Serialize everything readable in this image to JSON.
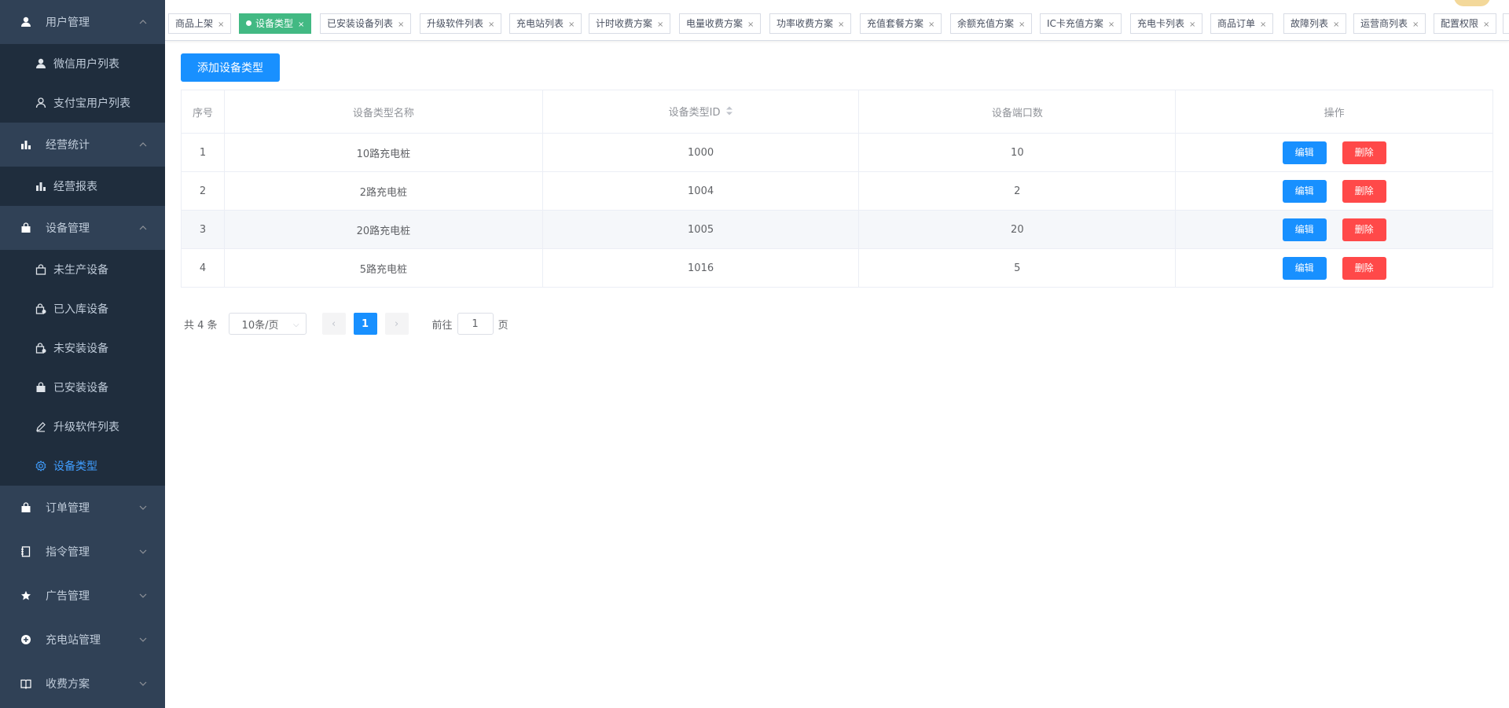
{
  "sidebar": {
    "groups": [
      {
        "label": "用户管理",
        "items": [
          "微信用户列表",
          "支付宝用户列表"
        ]
      },
      {
        "label": "经营统计",
        "items": [
          "经营报表"
        ]
      },
      {
        "label": "设备管理",
        "items": [
          "未生产设备",
          "已入库设备",
          "未安装设备",
          "已安装设备",
          "升级软件列表",
          "设备类型"
        ],
        "active_item": "设备类型"
      },
      {
        "label": "订单管理"
      },
      {
        "label": "指令管理"
      },
      {
        "label": "广告管理"
      },
      {
        "label": "充电站管理"
      },
      {
        "label": "收费方案"
      }
    ]
  },
  "tags": [
    "商品上架",
    "设备类型",
    "已安装设备列表",
    "升级软件列表",
    "充电站列表",
    "计时收费方案",
    "电量收费方案",
    "功率收费方案",
    "充值套餐方案",
    "余额充值方案",
    "IC卡充值方案",
    "充电卡列表",
    "商品订单",
    "故障列表",
    "运营商列表",
    "配置权限"
  ],
  "active_tag": "设备类型",
  "toolbar": {
    "add_label": "添加设备类型"
  },
  "table": {
    "headers": [
      "序号",
      "设备类型名称",
      "设备类型ID",
      "设备端口数",
      "操作"
    ],
    "rows": [
      {
        "index": "1",
        "name": "10路充电桩",
        "id": "1000",
        "ports": "10"
      },
      {
        "index": "2",
        "name": "2路充电桩",
        "id": "1004",
        "ports": "2"
      },
      {
        "index": "3",
        "name": "20路充电桩",
        "id": "1005",
        "ports": "20"
      },
      {
        "index": "4",
        "name": "5路充电桩",
        "id": "1016",
        "ports": "5"
      }
    ],
    "edit_label": "编辑",
    "delete_label": "删除"
  },
  "pagination": {
    "total_text": "共 4 条",
    "page_size": "10条/页",
    "current_page": "1",
    "goto_prefix": "前往",
    "goto_value": "1",
    "goto_suffix": "页"
  },
  "colors": {
    "sidebar_bg": "#304156",
    "submenu_bg": "#1f2d3d",
    "primary": "#1890ff",
    "danger": "#ff4949",
    "tag_active": "#42b983"
  }
}
